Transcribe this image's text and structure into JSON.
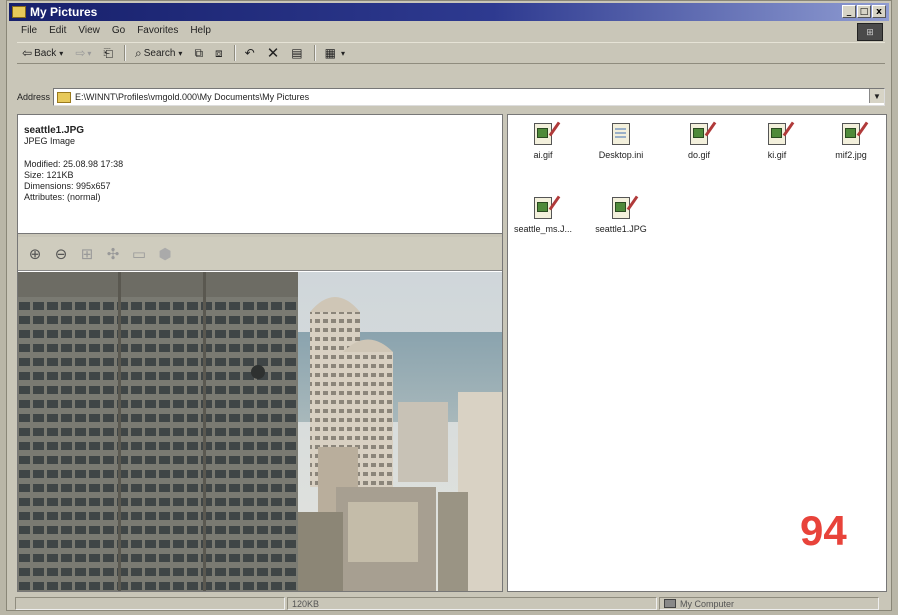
{
  "window": {
    "title": "My Pictures",
    "buttons": {
      "minimize": "_",
      "maximize": "□",
      "close": "x"
    }
  },
  "menu": [
    "File",
    "Edit",
    "View",
    "Go",
    "Favorites",
    "Help"
  ],
  "toolbar": {
    "back_label": "Back",
    "search_label": "Search"
  },
  "address": {
    "label": "Address",
    "value": "E:\\WINNT\\Profiles\\vmgold.000\\My Documents\\My Pictures"
  },
  "details": {
    "filename": "seattle1.JPG",
    "type": "JPEG Image",
    "modified": "Modified: 25.08.98 17:38",
    "size": "Size: 121KB",
    "dimensions": "Dimensions: 995x657",
    "attributes": "Attributes: (normal)"
  },
  "files": [
    {
      "name": "ai.gif",
      "icon": "image-file-icon"
    },
    {
      "name": "Desktop.ini",
      "icon": "settings-file-icon"
    },
    {
      "name": "do.gif",
      "icon": "image-file-icon"
    },
    {
      "name": "ki.gif",
      "icon": "image-file-icon"
    },
    {
      "name": "mif2.jpg",
      "icon": "image-file-icon"
    },
    {
      "name": "seattle_ms.J...",
      "icon": "image-file-icon"
    },
    {
      "name": "seattle1.JPG",
      "icon": "image-file-icon"
    }
  ],
  "status": {
    "size": "120KB",
    "zone": "My Computer"
  },
  "page_number": "94",
  "colors": {
    "titlebar_start": "#17206b",
    "titlebar_end": "#8f9cd2",
    "page_number": "#e8433a"
  }
}
